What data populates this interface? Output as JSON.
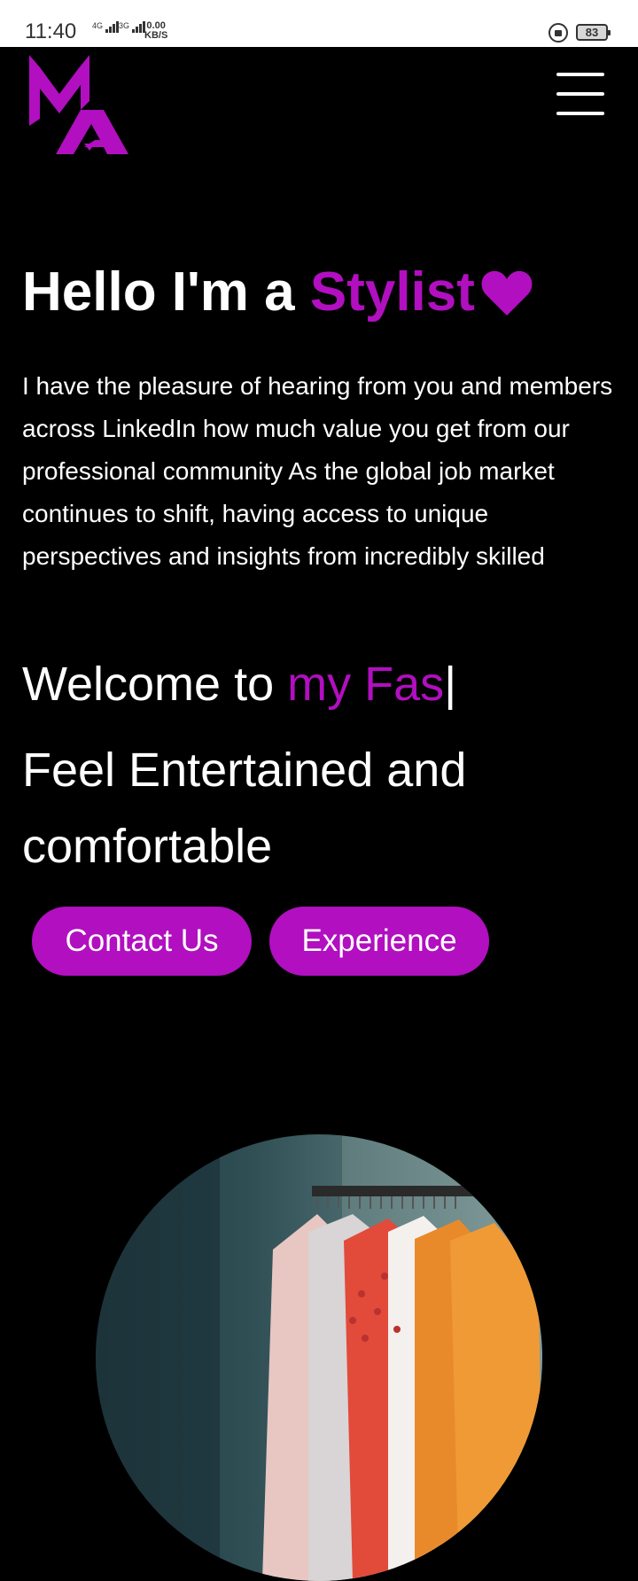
{
  "status_bar": {
    "time": "11:40",
    "signal_1": "4G",
    "signal_2": "3G",
    "net_speed_value": "0.00",
    "net_speed_unit": "KB/S",
    "battery": "83"
  },
  "header": {
    "logo_text": "MA",
    "brand_color": "#b10fc0",
    "menu_icon": "hamburger-menu-icon"
  },
  "hero": {
    "title_prefix": "Hello I'm a ",
    "title_accent": "Stylist",
    "heart_icon": "heart-icon",
    "intro": "I have the pleasure of hearing from you and members across LinkedIn how much value you get from our professional community As the global job market continues to shift, having access to unique perspectives and insights from incredibly skilled",
    "welcome_prefix": "Welcome to ",
    "welcome_typed": "my Fas",
    "cursor": "|",
    "tagline": "Feel Entertained and comfortable"
  },
  "buttons": {
    "contact": "Contact Us",
    "experience": "Experience"
  }
}
